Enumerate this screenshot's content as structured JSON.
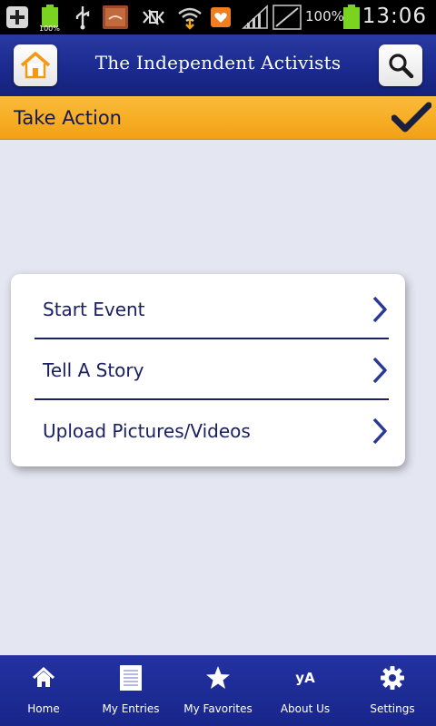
{
  "status_bar": {
    "battery_left_label": "100%",
    "battery_percent": "100%",
    "time": "13:06"
  },
  "header": {
    "title": "The Independent Activists",
    "home_icon": "house-icon",
    "search_icon": "magnifier-icon"
  },
  "section": {
    "title": "Take Action",
    "icon": "checkmark-icon"
  },
  "actions": {
    "items": [
      {
        "label": "Start Event",
        "icon": "chevron-right-icon"
      },
      {
        "label": "Tell A Story",
        "icon": "chevron-right-icon"
      },
      {
        "label": "Upload Pictures/Videos",
        "icon": "chevron-right-icon"
      }
    ]
  },
  "bottom_nav": {
    "items": [
      {
        "label": "Home",
        "icon": "house-icon"
      },
      {
        "label": "My Entries",
        "icon": "document-icon"
      },
      {
        "label": "My Favorites",
        "icon": "star-icon"
      },
      {
        "label": "About Us",
        "icon": "ya-logo-icon",
        "icon_text": "yA"
      },
      {
        "label": "Settings",
        "icon": "gear-icon"
      }
    ]
  },
  "colors": {
    "header_blue": "#1b2a8f",
    "section_orange": "#f7ac22",
    "text_navy": "#1b2063",
    "background": "#e4e6f1"
  }
}
